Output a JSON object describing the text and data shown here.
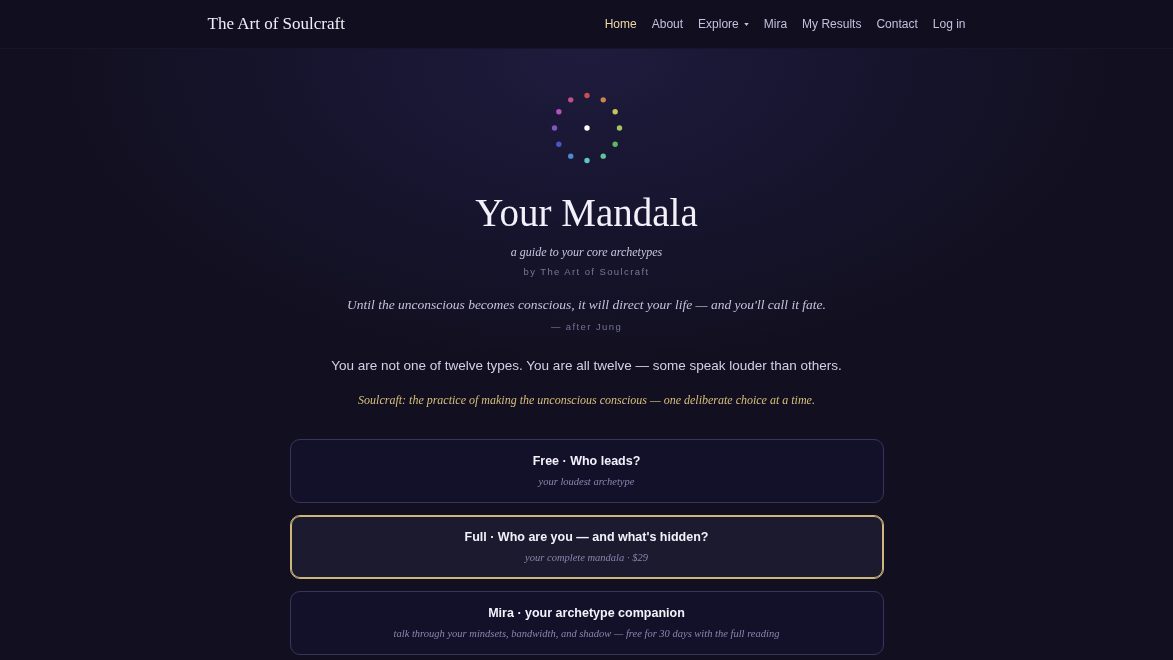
{
  "nav": {
    "brand": "The Art of Soulcraft",
    "links": [
      {
        "label": "Home",
        "selected": true,
        "dropdown": false
      },
      {
        "label": "About",
        "selected": false,
        "dropdown": false
      },
      {
        "label": "Explore",
        "selected": false,
        "dropdown": true
      },
      {
        "label": "Mira",
        "selected": false,
        "dropdown": false
      },
      {
        "label": "My Results",
        "selected": false,
        "dropdown": false
      },
      {
        "label": "Contact",
        "selected": false,
        "dropdown": false
      },
      {
        "label": "Log in",
        "selected": false,
        "dropdown": false
      }
    ]
  },
  "hero": {
    "title": "Your Mandala",
    "subtitle": "a guide to your core archetypes",
    "byline": "by The Art of Soulcraft",
    "quote": "Until the unconscious becomes conscious, it will direct your life — and you'll call it fate.",
    "quote_attribution": "— after Jung",
    "intro": "You are not one of twelve types. You are all twelve — some speak louder than others.",
    "definition": "Soulcraft: the practice of making the unconscious conscious — one deliberate choice at a time."
  },
  "options": [
    {
      "title": "Free · Who leads?",
      "subtitle": "your loudest archetype",
      "selected": false
    },
    {
      "title": "Full · Who are you — and what's hidden?",
      "subtitle": "your complete mandala · $29",
      "selected": true
    },
    {
      "title": "Mira · your archetype companion",
      "subtitle": "talk through your mindsets, bandwidth, and shadow — free for 30 days with the full reading",
      "selected": false
    }
  ]
}
